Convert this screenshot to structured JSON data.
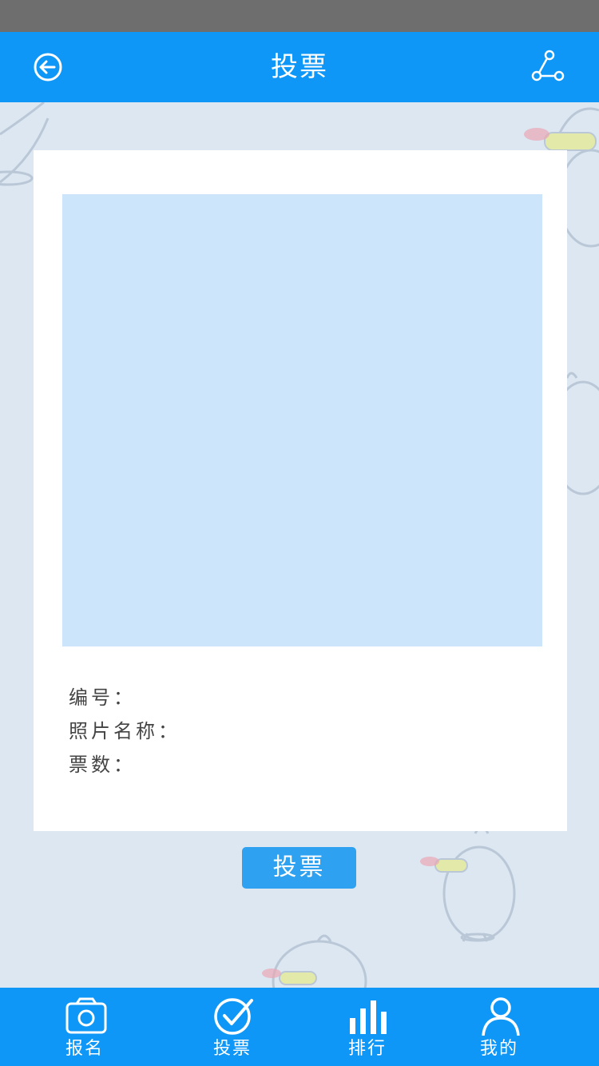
{
  "header": {
    "title": "投票",
    "back_icon": "back-circle-arrow-icon",
    "share_icon": "share-icon"
  },
  "card": {
    "fields": {
      "number_label": "编号：",
      "photo_name_label": "照片名称：",
      "votes_label": "票数："
    }
  },
  "vote_button": {
    "label": "投票"
  },
  "tabbar": {
    "items": [
      {
        "label": "报名",
        "icon": "camera-icon"
      },
      {
        "label": "投票",
        "icon": "check-circle-icon"
      },
      {
        "label": "排行",
        "icon": "bar-chart-icon"
      },
      {
        "label": "我的",
        "icon": "user-icon"
      }
    ]
  },
  "colors": {
    "primary": "#0f97f7",
    "button": "#2ea1f0",
    "background": "#dde7f2",
    "photo_placeholder": "#cce5fa",
    "status_bar": "#6e6e6e"
  }
}
